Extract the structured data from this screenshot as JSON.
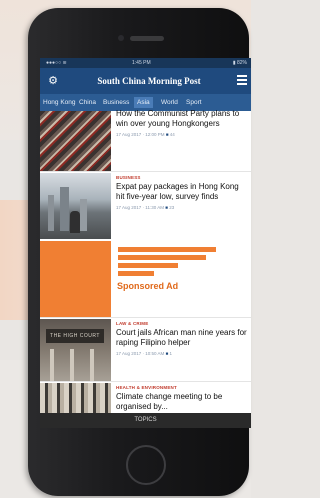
{
  "status_bar": {
    "signal": "●●●○○ ≋",
    "time": "1:45 PM",
    "battery": "▮ 82%"
  },
  "app": {
    "title": "South China Morning Post",
    "settings_icon": "gear-icon",
    "menu_icon": "hamburger-menu-icon"
  },
  "tabs": [
    {
      "label": "Hong Kong",
      "active": false
    },
    {
      "label": "China",
      "active": false
    },
    {
      "label": "Business",
      "active": false
    },
    {
      "label": "Asia",
      "active": true
    },
    {
      "label": "World",
      "active": false
    },
    {
      "label": "Sport",
      "active": false
    }
  ],
  "articles": [
    {
      "category": "",
      "headline": "How the Communist Party plans to win over young Hongkongers",
      "meta": "17 Aug 2017 · 12:00 PM",
      "comments": "44"
    },
    {
      "category": "BUSINESS",
      "headline": "Expat pay packages in Hong Kong hit five-year low, survey finds",
      "meta": "17 Aug 2017 · 11:30 AM",
      "comments": "23"
    },
    {
      "category": "LAW & CRIME",
      "headline": "Court jails African man nine years for raping Filipino helper",
      "meta": "17 Aug 2017 · 10:50 AM",
      "comments": "1"
    },
    {
      "category": "HEALTH & ENVIRONMENT",
      "headline": "Climate change meeting to be organised by...",
      "meta": "",
      "comments": ""
    }
  ],
  "ad": {
    "label": "Sponsored Ad"
  },
  "bottom_bar": {
    "label": "TOPICS"
  },
  "colors": {
    "brand_dark": "#1f4a7e",
    "tabs_bg": "#2c5c93",
    "ad_orange": "#f07f33",
    "category_red": "#c0392b"
  }
}
